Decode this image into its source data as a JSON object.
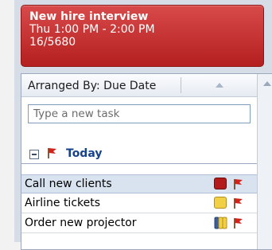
{
  "appointment": {
    "title": "New hire interview",
    "time": "Thu 1:00 PM - 2:00 PM",
    "location": "16/5680",
    "color": "#c62b2b"
  },
  "task_list": {
    "arranged_by": "Arranged By: Due Date",
    "new_task_placeholder": "Type a new task",
    "group": {
      "label": "Today",
      "icon": "flag-icon"
    },
    "tasks": [
      {
        "label": "Call new clients",
        "category": "red",
        "category_color": "#b31a1a",
        "flag_icon": "flag-icon",
        "selected": true
      },
      {
        "label": "Airline tickets",
        "category": "yellow",
        "category_color": "#f2d046",
        "flag_icon": "flag-icon",
        "selected": false
      },
      {
        "label": "Order new projector",
        "category": "multiple",
        "category_color": "#3d5d9c",
        "flag_icon": "flag-icon",
        "selected": false
      }
    ]
  },
  "colors": {
    "flag_red": "#d0241b",
    "header_text": "#15428b"
  }
}
